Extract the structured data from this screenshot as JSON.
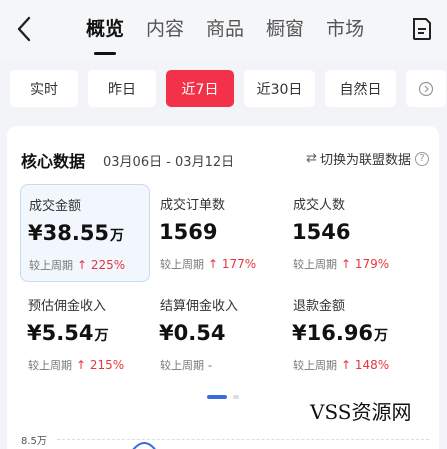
{
  "nav": {
    "tabs": [
      "概览",
      "内容",
      "商品",
      "橱窗",
      "市场"
    ],
    "active_tab": "概览"
  },
  "filters": {
    "options": [
      "实时",
      "昨日",
      "近7日",
      "近30日",
      "自然日"
    ],
    "selected": "近7日"
  },
  "card": {
    "title": "核心数据",
    "date_range": "03月06日 - 03月12日",
    "switch_label": "切换为联盟数据",
    "metrics": [
      {
        "label": "成交金额",
        "value": "¥38.55",
        "unit": "万",
        "cmp_label": "较上周期",
        "cmp_value": "↑ 225%",
        "selected": true
      },
      {
        "label": "成交订单数",
        "value": "1569",
        "unit": "",
        "cmp_label": "较上周期",
        "cmp_value": "↑ 177%"
      },
      {
        "label": "成交人数",
        "value": "1546",
        "unit": "",
        "cmp_label": "较上周期",
        "cmp_value": "↑ 179%"
      },
      {
        "label": "预估佣金收入",
        "value": "¥5.54",
        "unit": "万",
        "cmp_label": "较上周期",
        "cmp_value": "↑ 215%"
      },
      {
        "label": "结算佣金收入",
        "value": "¥0.54",
        "unit": "",
        "cmp_label": "较上周期",
        "cmp_value": "-"
      },
      {
        "label": "退款金额",
        "value": "¥16.96",
        "unit": "万",
        "cmp_label": "较上周期",
        "cmp_value": "↑ 148%"
      }
    ],
    "pager": {
      "pages": 2,
      "current": 1
    },
    "chart_axis_label": "8.5万"
  },
  "watermark": "VSS资源网",
  "colors": {
    "accent": "#f3324a",
    "up": "#e8363f",
    "pager": "#3a6ce0"
  }
}
